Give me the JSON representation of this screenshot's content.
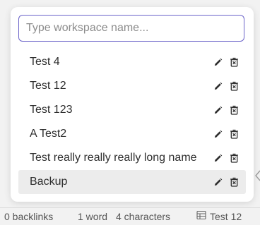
{
  "search": {
    "placeholder": "Type workspace name..."
  },
  "workspaces": [
    {
      "label": "Test 4"
    },
    {
      "label": "Test 12"
    },
    {
      "label": "Test 123"
    },
    {
      "label": "A Test2"
    },
    {
      "label": "Test really really really long name"
    },
    {
      "label": "Backup",
      "selected": true
    }
  ],
  "icons": {
    "edit": "pencil-icon",
    "delete": "trash-icon",
    "workspace": "table-icon"
  },
  "statusbar": {
    "backlinks": "0 backlinks",
    "words": "1 word",
    "characters": "4 characters",
    "workspace": "Test 12"
  },
  "colors": {
    "accent": "#6b63c9",
    "selected_row": "#ececec"
  }
}
